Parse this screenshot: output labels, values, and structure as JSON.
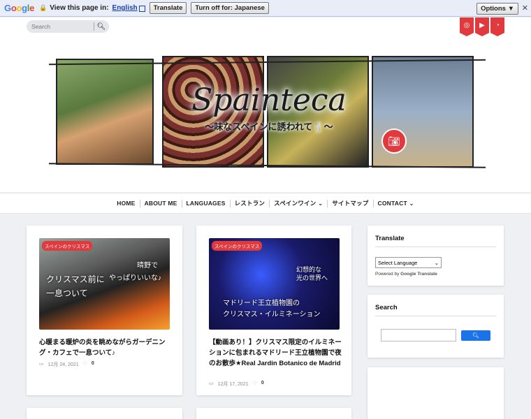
{
  "translate_bar": {
    "logo": [
      "G",
      "o",
      "o",
      "g",
      "l",
      "e"
    ],
    "view_text": "View this page in:",
    "language": "English",
    "translate_btn": "Translate",
    "turn_off_btn": "Turn off for: Japanese",
    "options_btn": "Options ▼",
    "close": "✕"
  },
  "header": {
    "search_placeholder": "Search",
    "social_icons": [
      "instagram-icon",
      "youtube-icon",
      "rss-icon"
    ],
    "brand": "Spainteca",
    "tagline": "〜味なスペインに誘われて🍴〜",
    "accent_color": "#e03a3e"
  },
  "nav": {
    "items": [
      "HOME",
      "ABOUT ME",
      "LANGUAGES",
      "レストラン",
      "スペインワイン ⌄",
      "サイトマップ",
      "CONTACT ⌄"
    ]
  },
  "posts": [
    {
      "category": "スペインのクリスマス",
      "caption_lines": [
        "クリスマス前に",
        "一息ついて",
        "晴野で",
        "やっぱりいいな♪"
      ],
      "title": "心暖まる暖炉の炎を眺めながらガーデニング・カフェで一息ついて♪",
      "date": "12月 24, 2021",
      "likes": "0"
    },
    {
      "category": "スペインのクリスマス",
      "caption_lines": [
        "幻想的な",
        "光の世界へ",
        "マドリード王立植物園の",
        "クリスマス・イルミネーション"
      ],
      "title": "【動画あり！】クリスマス限定のイルミネーションに包まれるマドリード王立植物園で夜のお散歩★Real Jardin Botanico de Madrid",
      "date": "12月 17, 2021",
      "likes": "0"
    }
  ],
  "sidebar": {
    "translate": {
      "title": "Translate",
      "select_label": "Select Language",
      "powered_by": "Powered by",
      "google": "Google",
      "translate_word": "Translate"
    },
    "search": {
      "title": "Search",
      "button_icon": "search-icon"
    }
  }
}
